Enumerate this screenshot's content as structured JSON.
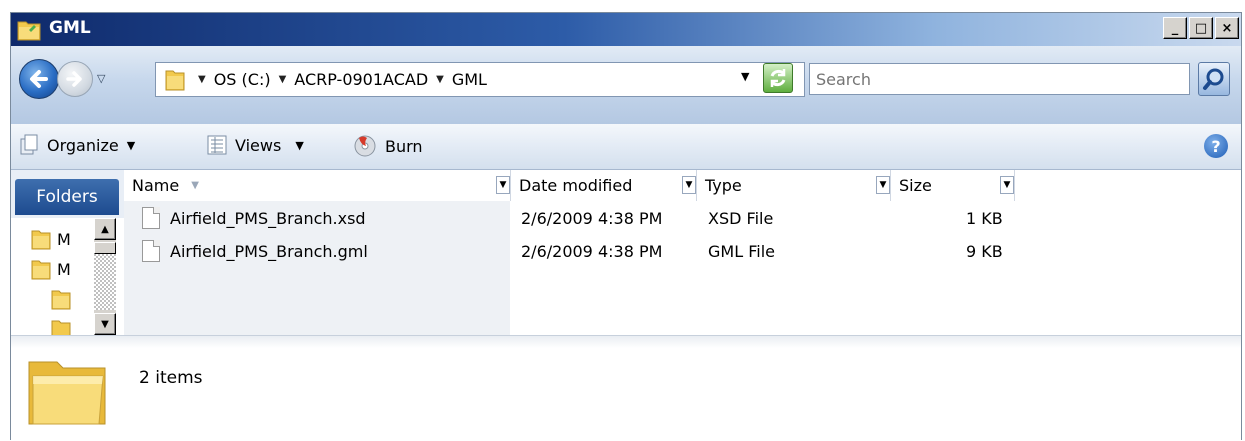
{
  "window": {
    "title": "GML",
    "controls": {
      "minimize": "_",
      "maximize": "□",
      "close": "×"
    }
  },
  "address_bar": {
    "breadcrumbs": [
      "OS (C:)",
      "ACRP-0901ACAD",
      "GML"
    ],
    "search_placeholder": "Search"
  },
  "toolbar": {
    "organize_label": "Organize",
    "views_label": "Views",
    "burn_label": "Burn",
    "help_label": "?"
  },
  "folders_pane": {
    "header": "Folders",
    "items": [
      "M",
      "M"
    ]
  },
  "columns": {
    "name": "Name",
    "date_modified": "Date modified",
    "type": "Type",
    "size": "Size"
  },
  "files": [
    {
      "name": "Airfield_PMS_Branch.xsd",
      "date": "2/6/2009 4:38 PM",
      "type": "XSD File",
      "size": "1 KB"
    },
    {
      "name": "Airfield_PMS_Branch.gml",
      "date": "2/6/2009 4:38 PM",
      "type": "GML File",
      "size": "9 KB"
    }
  ],
  "details": {
    "item_count": "2 items"
  },
  "colors": {
    "title_bar_dark": "#0f2a6b",
    "title_bar_light": "#c9d9ee",
    "address_bar": "#c6d7ec",
    "folder_yellow": "#f2c94c"
  }
}
